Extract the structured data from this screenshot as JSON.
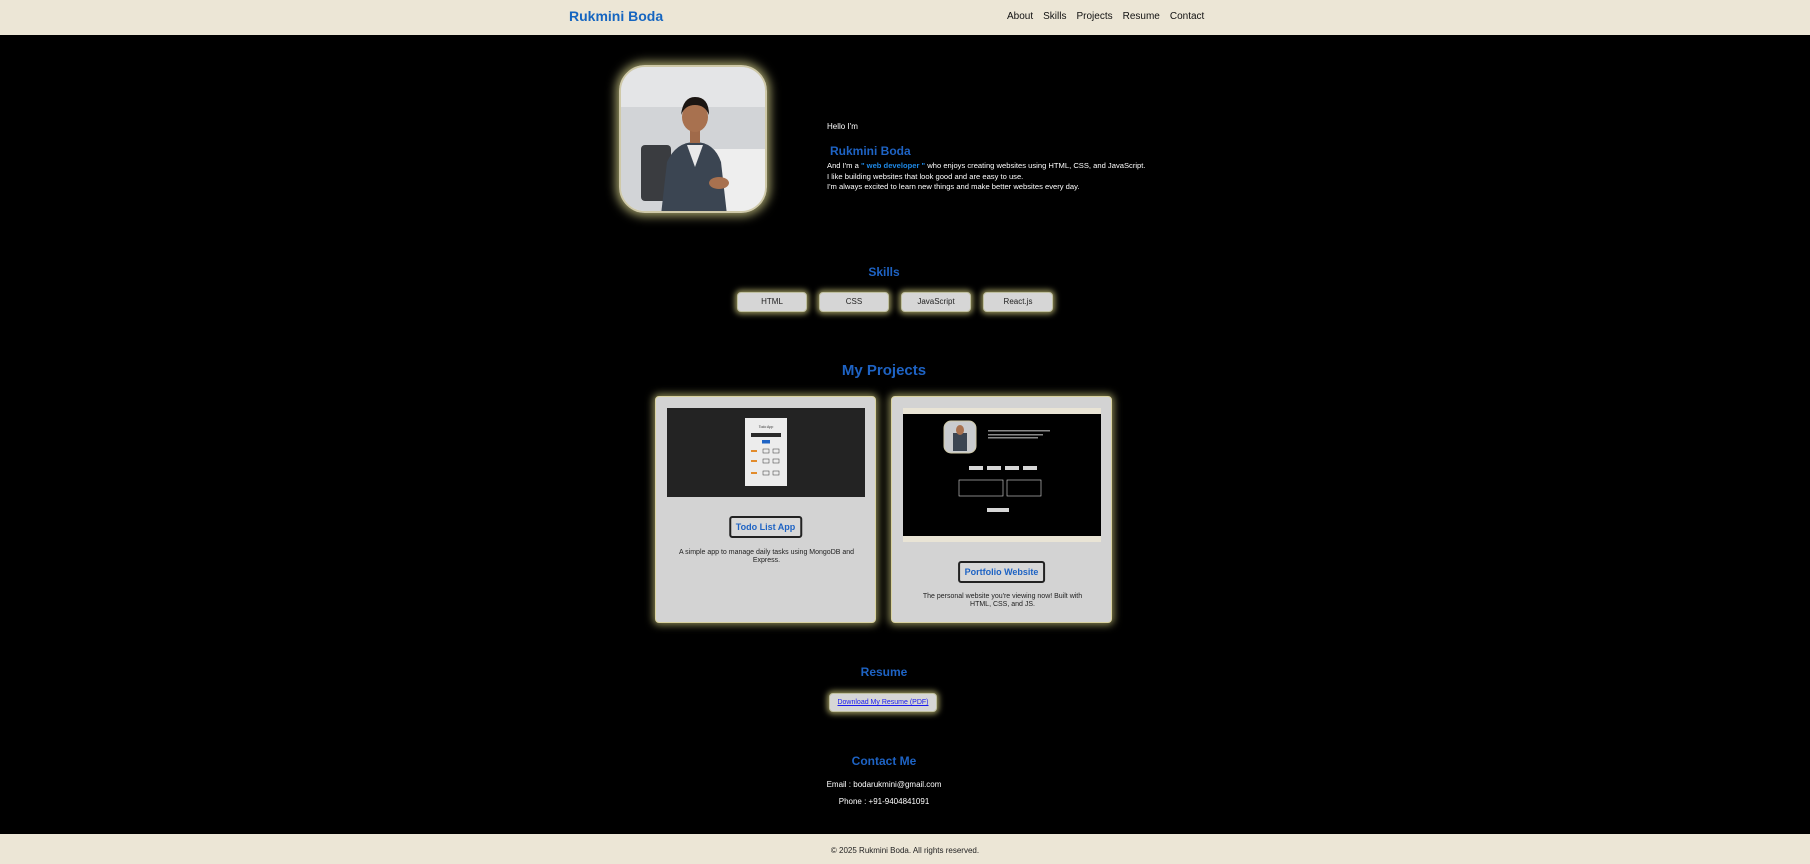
{
  "header": {
    "brand": "Rukmini Boda",
    "nav": [
      "About",
      "Skills",
      "Projects",
      "Resume",
      "Contact"
    ]
  },
  "hero": {
    "greeting": "Hello I'm",
    "name": "Rukmini Boda",
    "line1_prefix": "And I'm a",
    "role": "\" web developer \"",
    "line1_suffix": "who enjoys creating websites using HTML, CSS, and JavaScript.",
    "line2": "I like building websites that look good and are easy to use.",
    "line3": "I'm always excited to learn new things and make better websites every day."
  },
  "skills": {
    "title": "Skills",
    "items": [
      "HTML",
      "CSS",
      "JavaScript",
      "React.js"
    ]
  },
  "projects": {
    "title": "My Projects",
    "items": [
      {
        "title": "Todo List App",
        "description": "A simple app to manage daily tasks using MongoDB and Express.",
        "thumb_title": "Todo App"
      },
      {
        "title": "Portfolio Website",
        "description": "The personal website you're viewing now! Built with HTML, CSS, and JS."
      }
    ]
  },
  "resume": {
    "title": "Resume",
    "link": "Download My Resume (PDF)"
  },
  "contact": {
    "title": "Contact Me",
    "email": "Email : bodarukmini@gmail.com",
    "phone": "Phone : +91-9404841091"
  },
  "footer": {
    "text": "© 2025 Rukmini Boda. All rights reserved."
  },
  "colors": {
    "accent": "#1e63c4",
    "header_bg": "#ece6d6",
    "page_bg": "#000000",
    "card_bg": "#d3d3d3",
    "glow": "#e6e18c"
  },
  "icons": []
}
